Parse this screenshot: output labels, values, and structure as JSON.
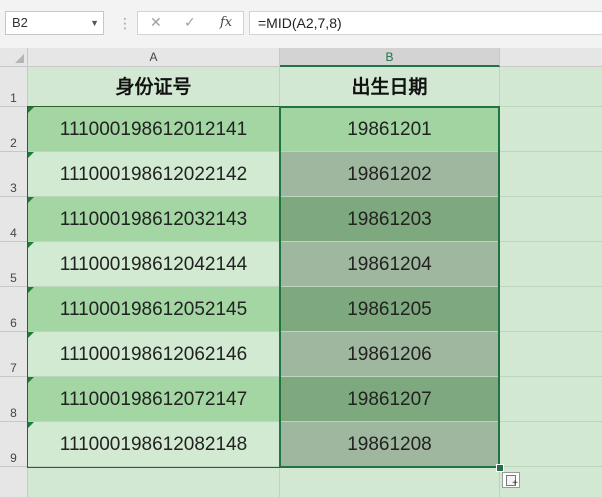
{
  "formula_bar": {
    "name_box": "B2",
    "cancel_glyph": "✕",
    "enter_glyph": "✓",
    "fx_label": "fx",
    "formula": "=MID(A2,7,8)"
  },
  "columns": [
    "A",
    "B"
  ],
  "row_numbers": [
    "1",
    "2",
    "3",
    "4",
    "5",
    "6",
    "7",
    "8",
    "9"
  ],
  "headers": {
    "a": "身份证号",
    "b": "出生日期"
  },
  "rows": [
    {
      "a": "111000198612012141",
      "b": "19861201"
    },
    {
      "a": "111000198612022142",
      "b": "19861202"
    },
    {
      "a": "111000198612032143",
      "b": "19861203"
    },
    {
      "a": "111000198612042144",
      "b": "19861204"
    },
    {
      "a": "111000198612052145",
      "b": "19861205"
    },
    {
      "a": "111000198612062146",
      "b": "19861206"
    },
    {
      "a": "111000198612072147",
      "b": "19861207"
    },
    {
      "a": "111000198612082148",
      "b": "19861208"
    }
  ],
  "colors": {
    "selection": "#217346",
    "b_shades": [
      "#a2d4a2",
      "#9fb79f",
      "#7ea87e",
      "#9fb79f",
      "#7ea87e",
      "#9fb79f",
      "#7ea87e",
      "#9fb79f"
    ]
  },
  "selection": {
    "active_cell": "B2",
    "range": "B2:B9"
  }
}
